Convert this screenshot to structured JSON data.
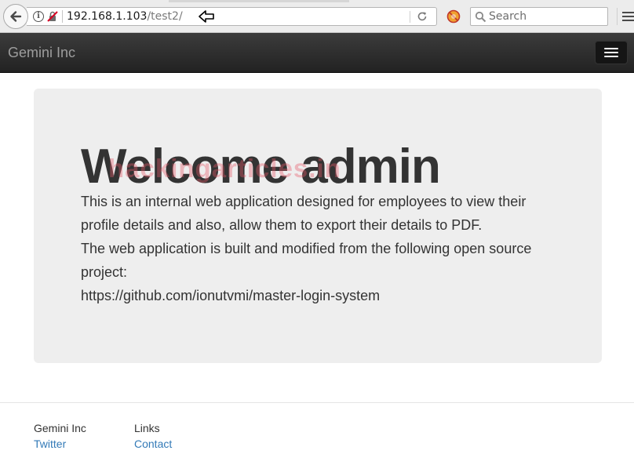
{
  "browser": {
    "url_host": "192.168.1.103",
    "url_path": "/test2/",
    "search_placeholder": "Search",
    "icons": [
      "back-arrow-icon",
      "info-icon",
      "insecure-connection-icon",
      "reload-icon",
      "addon-icon",
      "search-icon",
      "hamburger-menu-icon"
    ]
  },
  "navbar": {
    "brand": "Gemini Inc",
    "toggle_icon": "hamburger-menu-icon"
  },
  "jumbotron": {
    "heading": "Welcome admin",
    "watermark": "hackingarticles.in",
    "paragraphs": [
      "This is an internal web application designed for employees to view their profile details and also, allow them to export their details to PDF.",
      "The web application is built and modified from the following open source project:",
      "https://github.com/ionutvmi/master-login-system"
    ]
  },
  "footer": {
    "columns": [
      {
        "heading": "Gemini Inc",
        "link": "Twitter"
      },
      {
        "heading": "Links",
        "link": "Contact"
      }
    ]
  },
  "colors": {
    "navbar_bg": "#222222",
    "brand_text": "#9d9d9d",
    "jumbotron_bg": "#eeeeee",
    "body_text": "#333333",
    "link": "#337ab7",
    "watermark": "#e75a69"
  }
}
